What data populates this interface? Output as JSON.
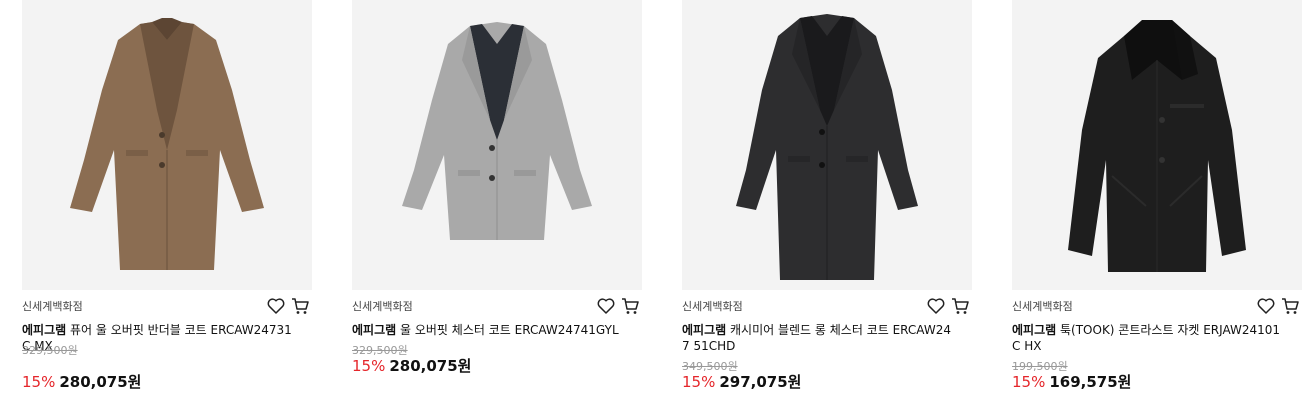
{
  "products": [
    {
      "store": "신세계백화점",
      "brand": "에피그램",
      "name": "퓨어 울 오버핏 반더블 코트 ERCAW24731C MX",
      "original_price": "329,500원",
      "discount_rate": "15%",
      "sale_price": "280,075원",
      "colors": {
        "coat": "#8b6d52",
        "lining": "#6e543e",
        "background": "#f3f3f3"
      },
      "icons": [
        "heart-icon",
        "cart-icon"
      ]
    },
    {
      "store": "신세계백화점",
      "brand": "에피그램",
      "name": "울 오버핏 체스터 코트 ERCAW24741GYL",
      "original_price": "329,500원",
      "discount_rate": "15%",
      "sale_price": "280,075원",
      "colors": {
        "coat": "#a9a9a9",
        "lining": "#2b2f36",
        "background": "#f3f3f3"
      },
      "icons": [
        "heart-icon",
        "cart-icon"
      ]
    },
    {
      "store": "신세계백화점",
      "brand": "에피그램",
      "name": "캐시미어 블렌드 롱 체스터 코트 ERCAW247 51CHD",
      "original_price": "349,500원",
      "discount_rate": "15%",
      "sale_price": "297,075원",
      "colors": {
        "coat": "#2d2d2f",
        "lining": "#1a1a1c",
        "background": "#f3f3f3"
      },
      "icons": [
        "heart-icon",
        "cart-icon"
      ]
    },
    {
      "store": "신세계백화점",
      "brand": "에피그램",
      "name": "툭(TOOK) 콘트라스트 자켓 ERJAW24101C HX",
      "original_price": "199,500원",
      "discount_rate": "15%",
      "sale_price": "169,575원",
      "colors": {
        "coat": "#1e1e1e",
        "lining": "#0f0f0f",
        "background": "#f3f3f3"
      },
      "icons": [
        "heart-icon",
        "cart-icon"
      ]
    }
  ],
  "accent_color": "#e5262b"
}
